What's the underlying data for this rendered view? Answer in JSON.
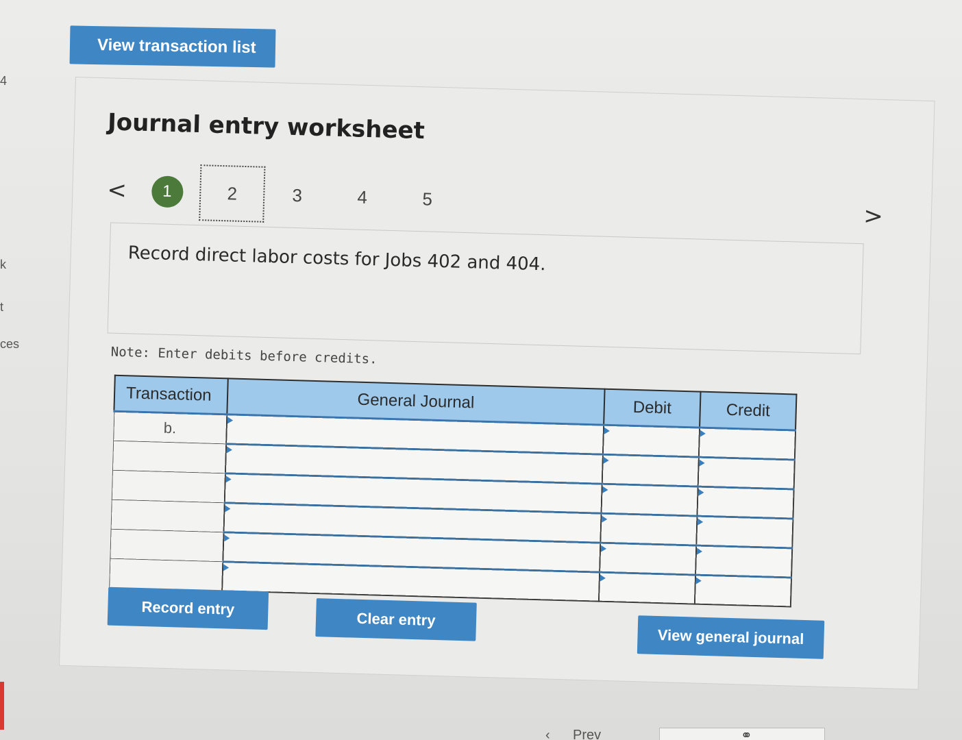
{
  "left_fragments": {
    "top": "4",
    "mid": "k",
    "mid2": "t",
    "low": "ces"
  },
  "top_button": {
    "label": "View transaction list"
  },
  "worksheet": {
    "title": "Journal entry worksheet",
    "pager": {
      "prev_label": "<",
      "next_label": ">",
      "pages": [
        "1",
        "2",
        "3",
        "4",
        "5"
      ],
      "completed": "1",
      "current": "2"
    },
    "description": "Record direct labor costs for Jobs 402 and 404.",
    "note": "Note: Enter debits before credits.",
    "table": {
      "headers": {
        "transaction": "Transaction",
        "general_journal": "General Journal",
        "debit": "Debit",
        "credit": "Credit"
      },
      "rows": [
        {
          "transaction": "b.",
          "account": "",
          "debit": "",
          "credit": ""
        },
        {
          "transaction": "",
          "account": "",
          "debit": "",
          "credit": ""
        },
        {
          "transaction": "",
          "account": "",
          "debit": "",
          "credit": ""
        },
        {
          "transaction": "",
          "account": "",
          "debit": "",
          "credit": ""
        },
        {
          "transaction": "",
          "account": "",
          "debit": "",
          "credit": ""
        },
        {
          "transaction": "",
          "account": "",
          "debit": "",
          "credit": ""
        }
      ]
    },
    "buttons": {
      "record": "Record entry",
      "clear": "Clear entry",
      "view_journal": "View general journal"
    }
  },
  "bottom": {
    "prev_fragment": "Prev"
  },
  "colors": {
    "button_blue": "#3f86c4",
    "header_blue": "#9fc9ea",
    "completed_green": "#4b7a3a"
  }
}
